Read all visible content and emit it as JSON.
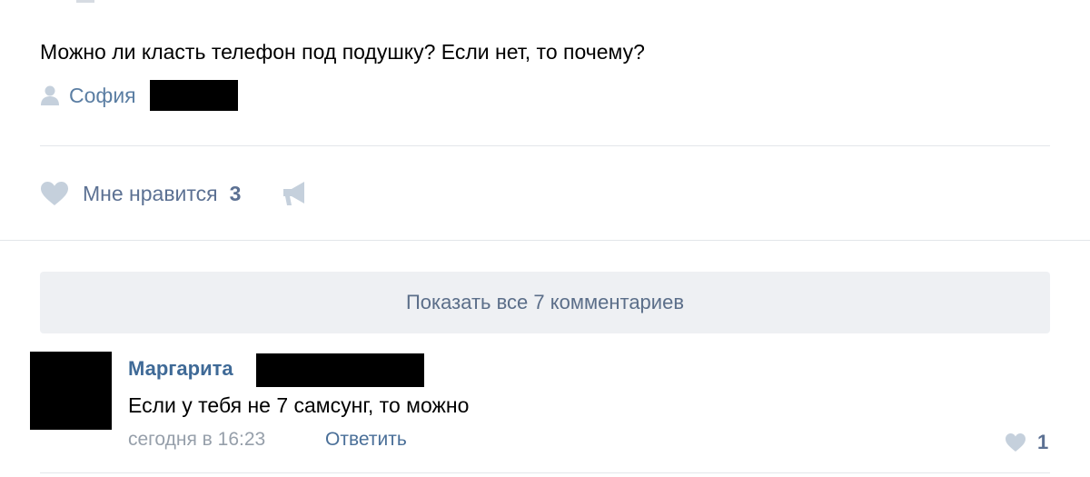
{
  "post": {
    "question": "Можно ли класть телефон под подушку? Если нет, то почему?",
    "author_name": "София"
  },
  "actions": {
    "like_label": "Мне нравится",
    "like_count": "3"
  },
  "comments": {
    "show_all_label": "Показать все 7 комментариев",
    "items": [
      {
        "author": "Маргарита",
        "text": "Если у тебя не 7 самсунг, то можно",
        "time": "сегодня в 16:23",
        "reply_label": "Ответить",
        "like_count": "1"
      }
    ]
  },
  "colors": {
    "link": "#5b7ea3",
    "icon": "#c5d0dc",
    "button_bg": "#eef0f3",
    "muted": "#969faa"
  },
  "icons": [
    "person-icon",
    "heart-icon",
    "share-megaphone-icon",
    "heart-small-icon"
  ]
}
